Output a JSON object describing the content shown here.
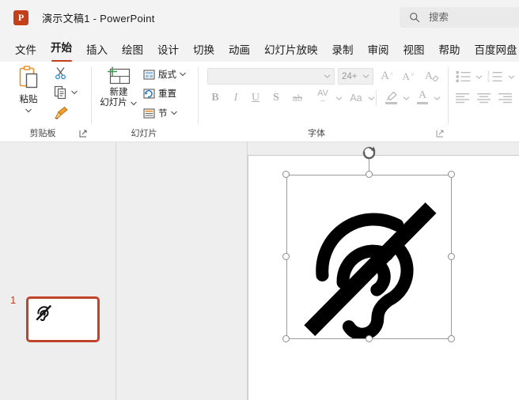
{
  "window": {
    "app_logo_letter": "P",
    "title": "演示文稿1  -  PowerPoint"
  },
  "search": {
    "placeholder": "搜索",
    "value": "",
    "icon": "search-icon"
  },
  "tabs": [
    {
      "label": "文件",
      "active": false
    },
    {
      "label": "开始",
      "active": true
    },
    {
      "label": "插入",
      "active": false
    },
    {
      "label": "绘图",
      "active": false
    },
    {
      "label": "设计",
      "active": false
    },
    {
      "label": "切换",
      "active": false
    },
    {
      "label": "动画",
      "active": false
    },
    {
      "label": "幻灯片放映",
      "active": false
    },
    {
      "label": "录制",
      "active": false
    },
    {
      "label": "审阅",
      "active": false
    },
    {
      "label": "视图",
      "active": false
    },
    {
      "label": "帮助",
      "active": false
    },
    {
      "label": "百度网盘",
      "active": false
    }
  ],
  "ribbon": {
    "groups": [
      {
        "name": "clipboard",
        "label": "剪贴板"
      },
      {
        "name": "slides",
        "label": "幻灯片"
      },
      {
        "name": "font",
        "label": "字体"
      }
    ],
    "clipboard": {
      "paste_label": "粘贴",
      "cut_icon": "scissors-icon",
      "copy_icon": "copy-icon",
      "format_painter_icon": "paintbrush-icon"
    },
    "slides": {
      "new_slide_line1": "新建",
      "new_slide_line2": "幻灯片",
      "layout_label": "版式",
      "reset_label": "重置",
      "section_label": "节"
    },
    "font": {
      "font_name_value": "",
      "font_size_value": "24+",
      "grow_font": "A",
      "shrink_font": "A",
      "clear_formatting": "A",
      "bold": "B",
      "italic": "I",
      "underline": "U",
      "shadow": "S",
      "strikethrough": "ab",
      "character_spacing": "AV",
      "change_case": "Aa",
      "text_highlight_icon": "highlighter-icon",
      "font_color_icon": "font-color-icon"
    },
    "paragraph": {
      "bullets_icon": "bulleted-list-icon",
      "numbering_icon": "numbered-list-icon",
      "align_left_icon": "align-left-icon",
      "align_center_icon": "align-center-icon",
      "align_right_icon": "align-right-icon"
    }
  },
  "thumbnails": [
    {
      "number": "1",
      "selected": true,
      "content_icon": "deaf-ear-icon"
    }
  ],
  "slide": {
    "selected_shape": {
      "name": "deaf-ear-icon",
      "description": "听障 / 耳朵加斜杠图标",
      "color": "#000000",
      "selected": true,
      "handles": 8,
      "rotation_handle": true
    }
  },
  "colors": {
    "accent": "#c43e1c",
    "titlebar_bg": "#f3f3f3",
    "ribbon_bg": "#ffffff",
    "workarea_bg": "#eeeeee",
    "canvas_bg": "#ffffff",
    "disabled_text": "#b4b4b4"
  }
}
